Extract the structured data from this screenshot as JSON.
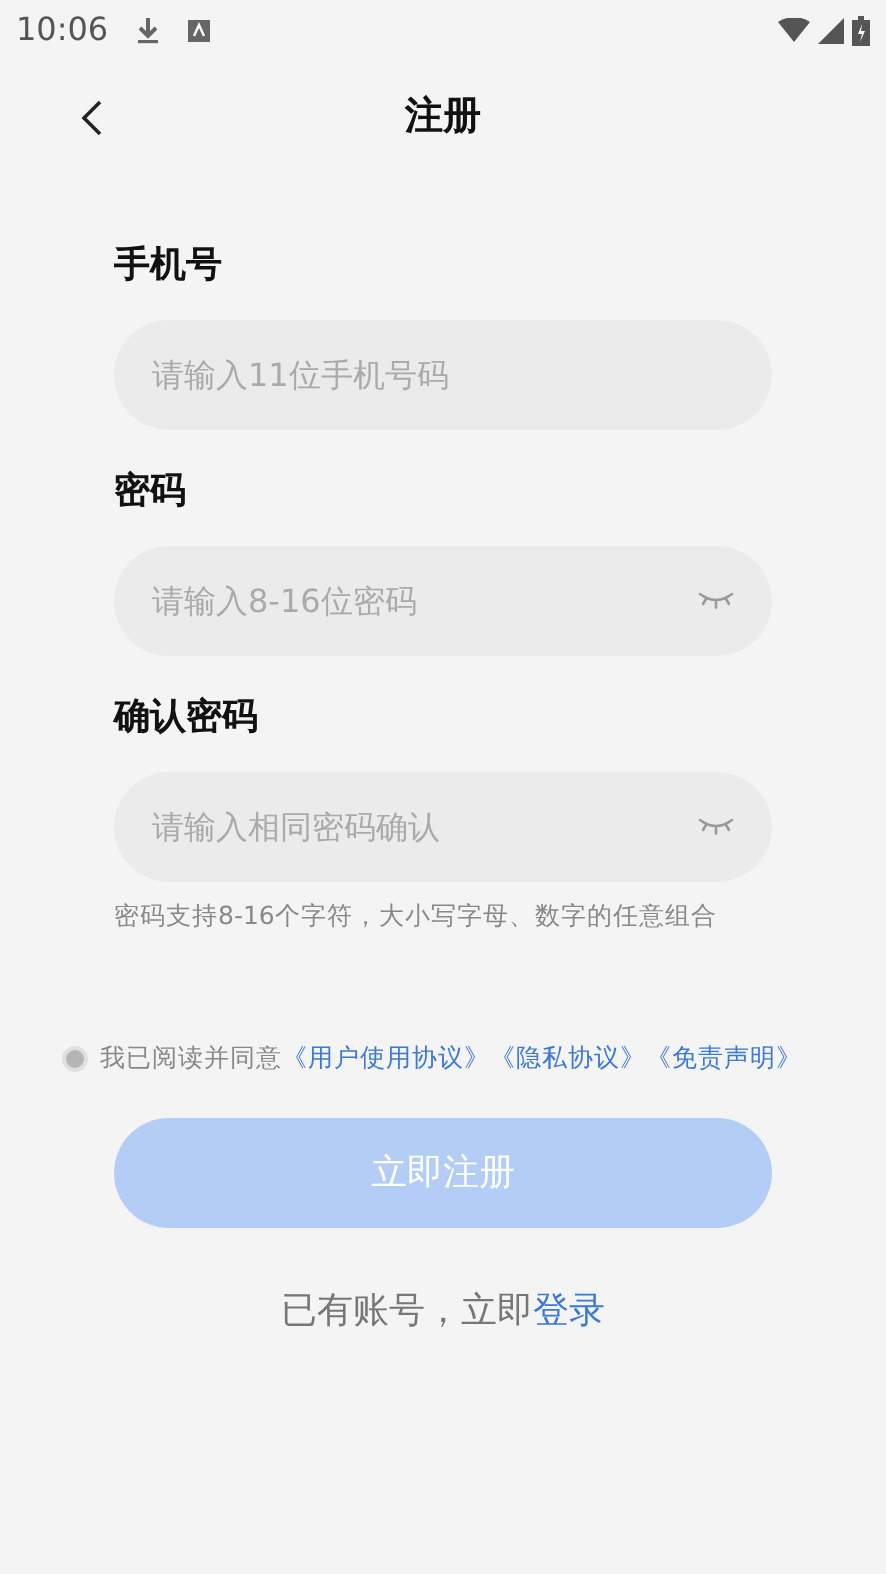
{
  "status_bar": {
    "time": "10:06"
  },
  "header": {
    "title": "注册"
  },
  "fields": [
    {
      "label": "手机号",
      "placeholder": "请输入11位手机号码",
      "kind": "text"
    },
    {
      "label": "密码",
      "placeholder": "请输入8-16位密码",
      "kind": "password"
    },
    {
      "label": "确认密码",
      "placeholder": "请输入相同密码确认",
      "kind": "password"
    }
  ],
  "hint": "密码支持8-16个字符，大小写字母、数字的任意组合",
  "agreement": {
    "checked": false,
    "text": "我已阅读并同意",
    "links": [
      "《用户使用协议》",
      "《隐私协议》",
      "《免责声明》"
    ]
  },
  "register_button": {
    "label": "立即注册",
    "disabled": true
  },
  "login_prompt": {
    "text": "已有账号，立即",
    "link": "登录"
  }
}
